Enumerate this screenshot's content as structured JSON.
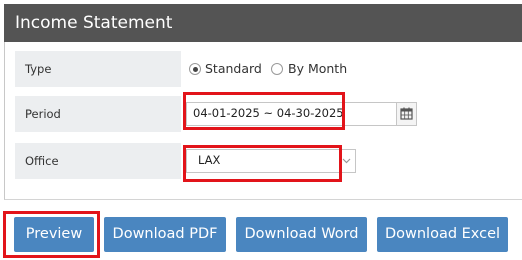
{
  "title": "Income Statement",
  "form": {
    "type_label": "Type",
    "type_options": [
      "Standard",
      "By Month"
    ],
    "type_selected": "Standard",
    "period_label": "Period",
    "period_value": "04-01-2025 ~ 04-30-2025",
    "office_label": "Office",
    "office_value": "LAX"
  },
  "buttons": {
    "preview": "Preview",
    "pdf": "Download PDF",
    "word": "Download Word",
    "excel": "Download Excel"
  },
  "colors": {
    "header_bg": "#545454",
    "button_bg": "#4a86c0",
    "highlight": "#e2141a",
    "label_bg": "#eceef0"
  },
  "icons": {
    "calendar": "calendar-icon",
    "dropdown": "chevron-down-icon"
  }
}
